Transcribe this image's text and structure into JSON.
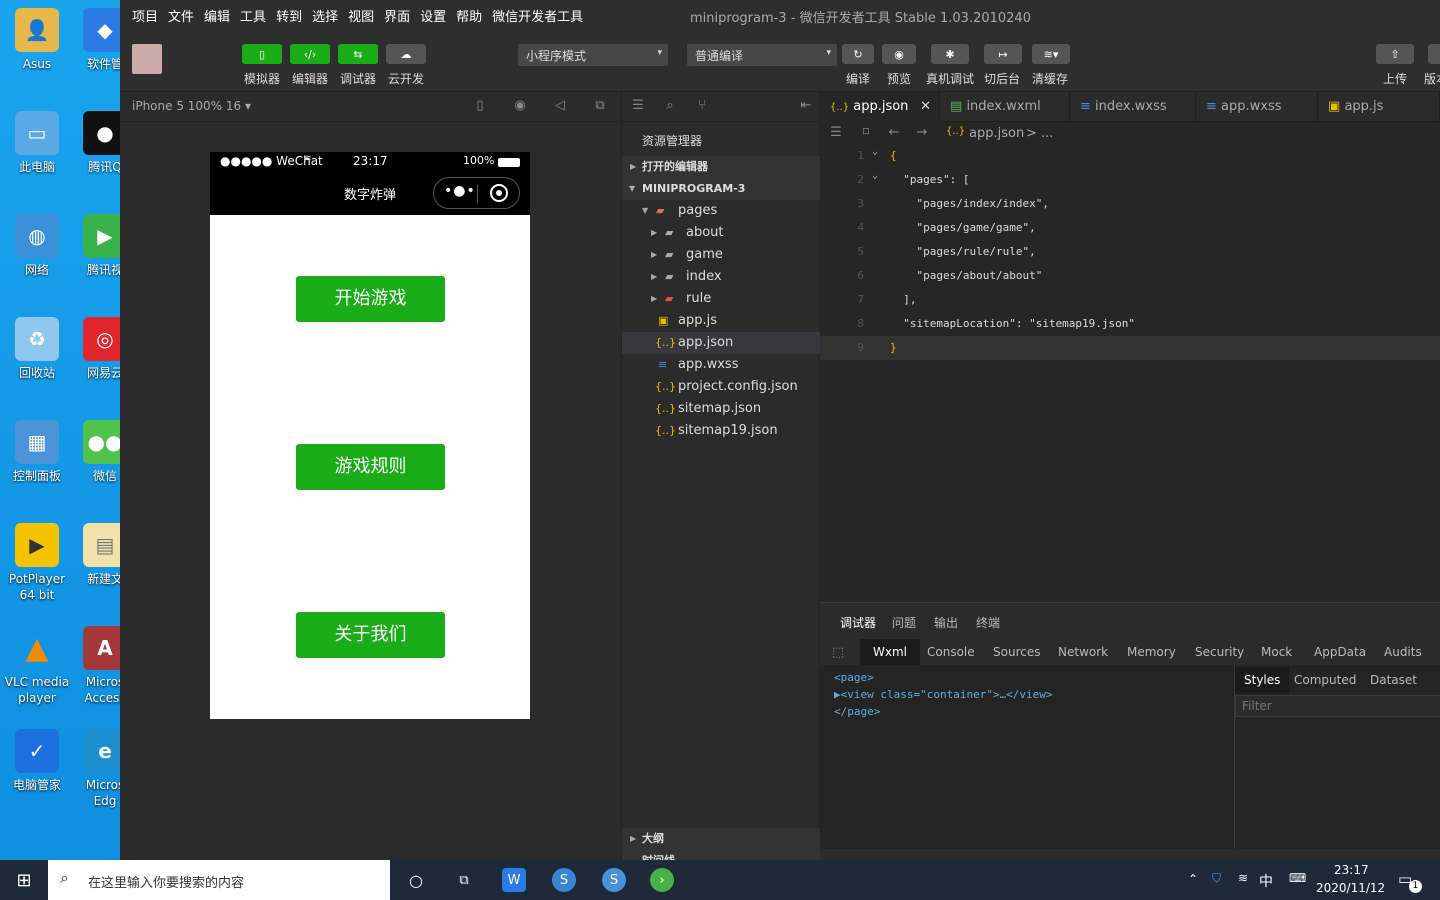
{
  "desktop": {
    "icons": [
      {
        "label": "Asus"
      },
      {
        "label": "软件管"
      },
      {
        "label": "此电脑"
      },
      {
        "label": "腾讯Q"
      },
      {
        "label": "网络"
      },
      {
        "label": "腾讯视"
      },
      {
        "label": "回收站"
      },
      {
        "label": "网易云"
      },
      {
        "label": "控制面板"
      },
      {
        "label": "微信"
      },
      {
        "label": "PotPlayer\n64 bit"
      },
      {
        "label": "新建文"
      },
      {
        "label": "VLC media\nplayer"
      },
      {
        "label": "Micros\nAccess"
      },
      {
        "label": "电脑管家"
      },
      {
        "label": "Micros\nEdg"
      }
    ]
  },
  "menubar": {
    "items": [
      "项目",
      "文件",
      "编辑",
      "工具",
      "转到",
      "选择",
      "视图",
      "界面",
      "设置",
      "帮助",
      "微信开发者工具"
    ],
    "title": "miniprogram-3",
    "title_sep": " - ",
    "app_name": "微信开发者工具 Stable 1.03.2010240"
  },
  "toolbar": {
    "simulator": "模拟器",
    "editor": "编辑器",
    "debugger": "调试器",
    "cloud": "云开发",
    "mode_select": "小程序模式",
    "compile_select": "普通编译",
    "compile": "编译",
    "preview": "预览",
    "device_debug": "真机调试",
    "background": "切后台",
    "clear_cache": "清缓存",
    "upload": "上传",
    "version": "版本"
  },
  "simulator": {
    "device": "iPhone 5 100% 16 ▾",
    "status_carrier": "●●●●● WeChat",
    "status_time": "23:17",
    "status_battery": "100%",
    "nav_title": "数字炸弹",
    "buttons": [
      "开始游戏",
      "游戏规则",
      "关于我们"
    ]
  },
  "explorer": {
    "title": "资源管理器",
    "open_editors": "打开的编辑器",
    "project": "MINIPROGRAM-3",
    "pages": "pages",
    "folders": [
      "about",
      "game",
      "index",
      "rule"
    ],
    "files": [
      "app.js",
      "app.json",
      "app.wxss",
      "project.config.json",
      "sitemap.json",
      "sitemap19.json"
    ],
    "outline": "大纲",
    "timeline": "时间线"
  },
  "editor": {
    "tabs": [
      "app.json",
      "index.wxml",
      "index.wxss",
      "app.wxss",
      "app.js"
    ],
    "breadcrumb": "app.json",
    "breadcrumb_more": "> ...",
    "lines": [
      {
        "n": "1",
        "text": "{"
      },
      {
        "n": "2",
        "text": "  \"pages\": ["
      },
      {
        "n": "3",
        "text": "    \"pages/index/index\","
      },
      {
        "n": "4",
        "text": "    \"pages/game/game\","
      },
      {
        "n": "5",
        "text": "    \"pages/rule/rule\","
      },
      {
        "n": "6",
        "text": "    \"pages/about/about\""
      },
      {
        "n": "7",
        "text": "  ],"
      },
      {
        "n": "8",
        "text": "  \"sitemapLocation\": \"sitemap19.json\""
      },
      {
        "n": "9",
        "text": "}"
      }
    ]
  },
  "debugger": {
    "top_tabs": [
      "调试器",
      "问题",
      "输出",
      "终端"
    ],
    "tabs": [
      "Wxml",
      "Console",
      "Sources",
      "Network",
      "Memory",
      "Security",
      "Mock",
      "AppData",
      "Audits"
    ],
    "dom_lines": [
      "<page>",
      "▶<view class=\"container\">…</view>",
      "</page>"
    ],
    "style_tabs": [
      "Styles",
      "Computed",
      "Dataset"
    ],
    "filter_placeholder": "Filter"
  },
  "taskbar": {
    "search_placeholder": "在这里输入你要搜索的内容",
    "ime": "中",
    "time": "23:17",
    "date": "2020/11/12",
    "notifications": "1"
  },
  "colors": {
    "wechat_green": "#1aad19",
    "desktop_blue": "#1aa4ee",
    "ide_bg": "#2b2b2b"
  }
}
